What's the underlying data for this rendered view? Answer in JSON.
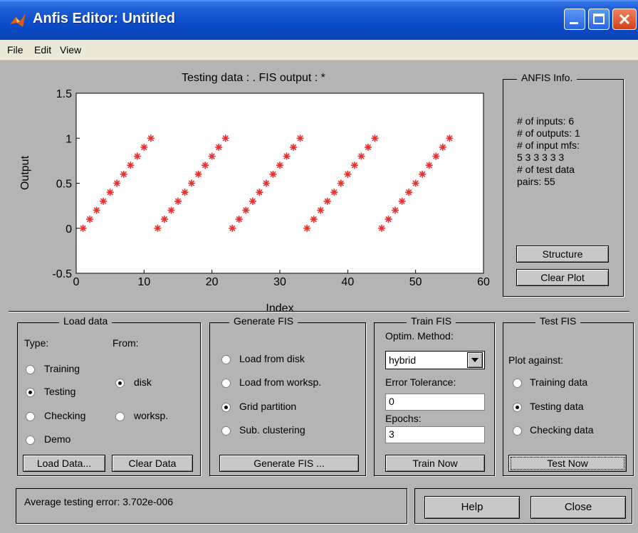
{
  "window": {
    "title": "Anfis Editor: Untitled"
  },
  "menu": [
    "File",
    "Edit",
    "View"
  ],
  "plot": {
    "title": "Testing data : .   FIS output : *",
    "xlabel": "Index",
    "ylabel": "Output",
    "xticks": [
      "0",
      "10",
      "20",
      "30",
      "40",
      "50",
      "60"
    ],
    "yticks": [
      "1.5",
      "1",
      "0.5",
      "0",
      "-0.5"
    ]
  },
  "chart_data": {
    "type": "scatter",
    "xlim": [
      0,
      60
    ],
    "ylim": [
      -0.5,
      1.5
    ],
    "marker": "*",
    "marker_color": "#e83030",
    "series": [
      {
        "x": [
          1,
          2,
          3,
          4,
          5,
          6,
          7,
          8,
          9,
          10,
          11
        ],
        "y": [
          0,
          0.1,
          0.2,
          0.3,
          0.4,
          0.5,
          0.6,
          0.7,
          0.8,
          0.9,
          1.0
        ]
      },
      {
        "x": [
          12,
          13,
          14,
          15,
          16,
          17,
          18,
          19,
          20,
          21,
          22
        ],
        "y": [
          0,
          0.1,
          0.2,
          0.3,
          0.4,
          0.5,
          0.6,
          0.7,
          0.8,
          0.9,
          1.0
        ]
      },
      {
        "x": [
          23,
          24,
          25,
          26,
          27,
          28,
          29,
          30,
          31,
          32,
          33
        ],
        "y": [
          0,
          0.1,
          0.2,
          0.3,
          0.4,
          0.5,
          0.6,
          0.7,
          0.8,
          0.9,
          1.0
        ]
      },
      {
        "x": [
          34,
          35,
          36,
          37,
          38,
          39,
          40,
          41,
          42,
          43,
          44
        ],
        "y": [
          0,
          0.1,
          0.2,
          0.3,
          0.4,
          0.5,
          0.6,
          0.7,
          0.8,
          0.9,
          1.0
        ]
      },
      {
        "x": [
          45,
          46,
          47,
          48,
          49,
          50,
          51,
          52,
          53,
          54,
          55
        ],
        "y": [
          0,
          0.1,
          0.2,
          0.3,
          0.4,
          0.5,
          0.6,
          0.7,
          0.8,
          0.9,
          1.0
        ]
      }
    ]
  },
  "anfis_info": {
    "title": "ANFIS Info.",
    "lines": [
      "# of inputs: 6",
      "# of outputs: 1",
      "# of input mfs:",
      "5  3  3  3  3  3",
      "# of test data",
      "pairs: 55"
    ],
    "structure_label": "Structure",
    "clear_plot_label": "Clear Plot"
  },
  "load_data": {
    "title": "Load data",
    "type_label": "Type:",
    "from_label": "From:",
    "types": [
      "Training",
      "Testing",
      "Checking",
      "Demo"
    ],
    "selected_type": "Testing",
    "sources": [
      "disk",
      "worksp."
    ],
    "selected_source": "disk",
    "load_button": "Load Data...",
    "clear_button": "Clear Data"
  },
  "generate_fis": {
    "title": "Generate FIS",
    "options": [
      "Load from disk",
      "Load from worksp.",
      "Grid partition",
      "Sub. clustering"
    ],
    "selected": "Grid partition",
    "button": "Generate FIS ..."
  },
  "train_fis": {
    "title": "Train FIS",
    "method_label": "Optim. Method:",
    "method_value": "hybrid",
    "tolerance_label": "Error Tolerance:",
    "tolerance_value": "0",
    "epochs_label": "Epochs:",
    "epochs_value": "3",
    "button": "Train Now"
  },
  "test_fis": {
    "title": "Test FIS",
    "plot_against_label": "Plot against:",
    "options": [
      "Training data",
      "Testing data",
      "Checking data"
    ],
    "selected": "Testing data",
    "button": "Test Now"
  },
  "status": {
    "message": "Average testing error: 3.702e-006"
  },
  "footer": {
    "help_label": "Help",
    "close_label": "Close"
  }
}
